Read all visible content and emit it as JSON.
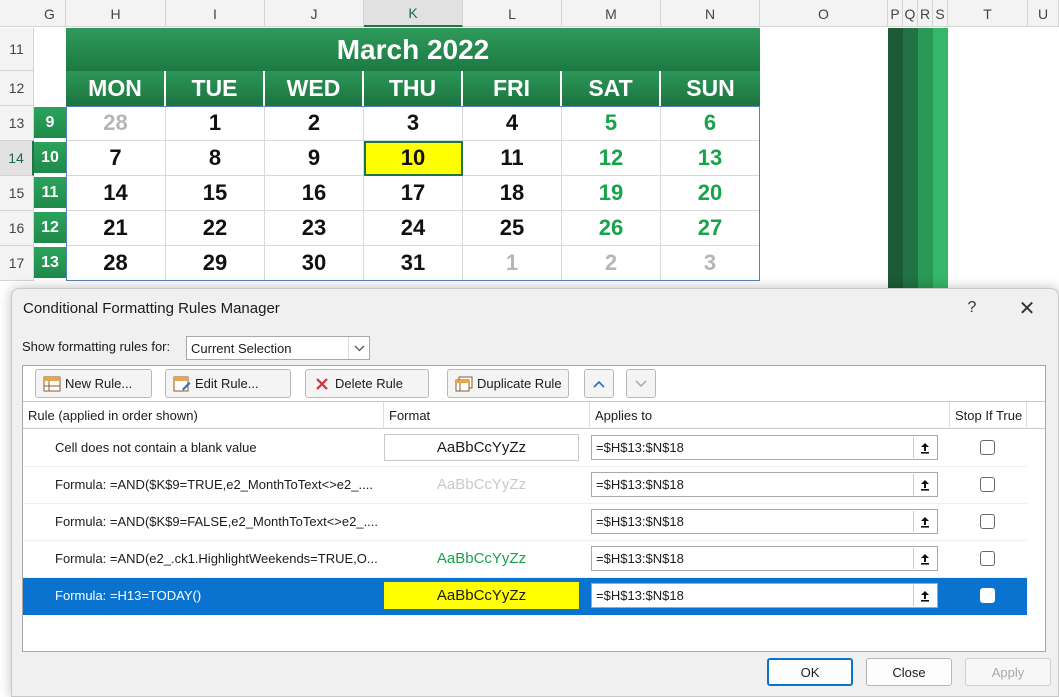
{
  "sheet": {
    "columns": [
      "G",
      "H",
      "I",
      "J",
      "K",
      "L",
      "M",
      "N",
      "O",
      "P",
      "Q",
      "R",
      "S",
      "T",
      "U"
    ],
    "active_column": "K",
    "rows": [
      "11",
      "12",
      "13",
      "14",
      "15",
      "16",
      "17"
    ],
    "active_row": "14"
  },
  "calendar": {
    "title": "March 2022",
    "day_headers": [
      "MON",
      "TUE",
      "WED",
      "THU",
      "FRI",
      "SAT",
      "SUN"
    ],
    "week_numbers": [
      "9",
      "10",
      "11",
      "12",
      "13"
    ],
    "weeks": [
      [
        "28",
        "1",
        "2",
        "3",
        "4",
        "5",
        "6"
      ],
      [
        "7",
        "8",
        "9",
        "10",
        "11",
        "12",
        "13"
      ],
      [
        "14",
        "15",
        "16",
        "17",
        "18",
        "19",
        "20"
      ],
      [
        "21",
        "22",
        "23",
        "24",
        "25",
        "26",
        "27"
      ],
      [
        "28",
        "29",
        "30",
        "31",
        "1",
        "2",
        "3"
      ]
    ],
    "today": "10",
    "colors": {
      "header_green": "#1d7a43",
      "weekend_green": "#17a34a",
      "today_yellow": "#ffff00",
      "other_month_gray": "#b6b6b6"
    }
  },
  "dialog": {
    "title": "Conditional Formatting Rules Manager",
    "help_glyph": "?",
    "close_glyph": "✕",
    "show_label": "Show formatting rules for:",
    "scope_value": "Current Selection",
    "toolbar": {
      "new_rule": "New Rule...",
      "edit_rule": "Edit Rule...",
      "delete_rule": "Delete Rule",
      "duplicate_rule": "Duplicate Rule"
    },
    "columns": {
      "rule": "Rule (applied in order shown)",
      "format": "Format",
      "applies_to": "Applies to",
      "stop_if_true": "Stop If True"
    },
    "preview_text": "AaBbCcYyZz",
    "rules": [
      {
        "description": "Cell does not contain a blank value",
        "applies_to": "=$H$13:$N$18"
      },
      {
        "description": "Formula: =AND($K$9=TRUE,e2_MonthToText<>e2_....",
        "applies_to": "=$H$13:$N$18"
      },
      {
        "description": "Formula: =AND($K$9=FALSE,e2_MonthToText<>e2_....",
        "applies_to": "=$H$13:$N$18"
      },
      {
        "description": "Formula: =AND(e2_.ck1.HighlightWeekends=TRUE,O...",
        "applies_to": "=$H$13:$N$18"
      },
      {
        "description": "Formula: =H13=TODAY()",
        "applies_to": "=$H$13:$N$18"
      }
    ],
    "buttons": {
      "ok": "OK",
      "close": "Close",
      "apply": "Apply"
    },
    "accent": "#0a73d0"
  }
}
